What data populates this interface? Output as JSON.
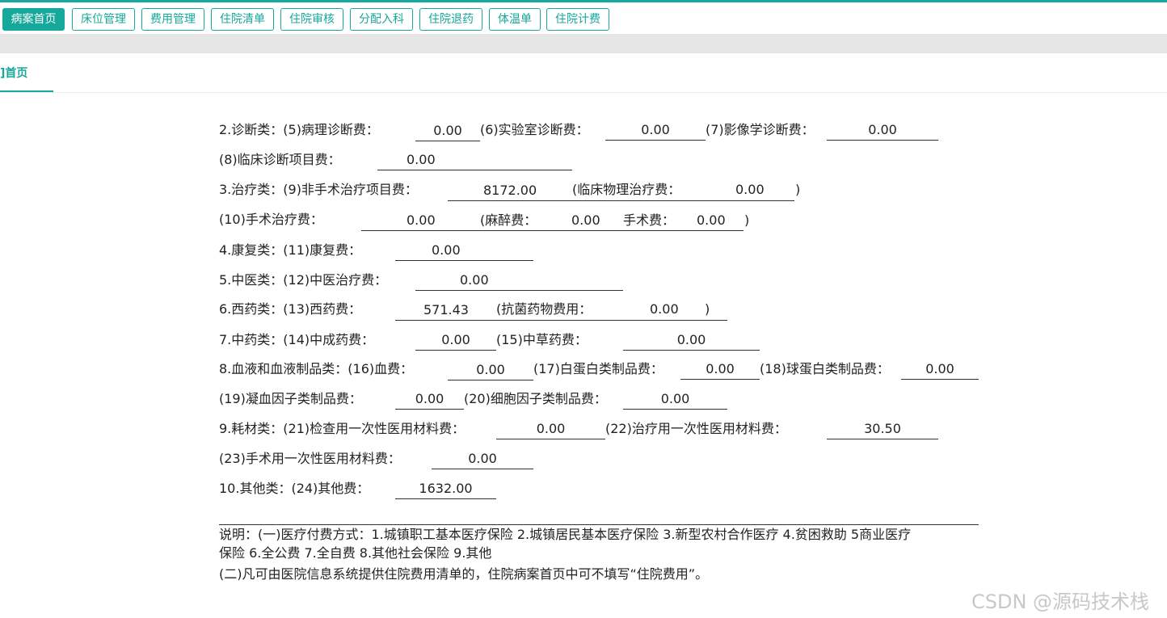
{
  "top_tabs": [
    {
      "label": "病案首页",
      "active": true
    },
    {
      "label": "床位管理"
    },
    {
      "label": "费用管理"
    },
    {
      "label": "住院清单"
    },
    {
      "label": "住院审核"
    },
    {
      "label": "分配入科"
    },
    {
      "label": "住院退药"
    },
    {
      "label": "体温单"
    },
    {
      "label": "住院计费"
    }
  ],
  "page_tab": {
    "label": "]首页"
  },
  "form": {
    "r1": {
      "a": "2.诊断类：(5)病理诊断费：",
      "v1": "0.00",
      "b": "(6)实验室诊断费：",
      "v2": "0.00",
      "c": "(7)影像学诊断费：",
      "v3": "0.00"
    },
    "r2": {
      "a": "(8)临床诊断项目费：",
      "v1": "0.00"
    },
    "r3": {
      "a": "3.治疗类：(9)非手术治疗项目费：",
      "v1": "8172.00",
      "b": "(临床物理治疗费：",
      "v2": "0.00",
      "close": ")"
    },
    "r4": {
      "a": "(10)手术治疗费：",
      "v1": "0.00",
      "b": "(麻醉费：",
      "v2": "0.00",
      "c": "手术费：",
      "v3": "0.00",
      "close": ")"
    },
    "r5": {
      "a": "4.康复类：(11)康复费：",
      "v1": "0.00"
    },
    "r6": {
      "a": "5.中医类：(12)中医治疗费：",
      "v1": "0.00"
    },
    "r7": {
      "a": "6.西药类：(13)西药费：",
      "v1": "571.43",
      "b": "(抗菌药物费用：",
      "v2": "0.00",
      "close": ")"
    },
    "r8": {
      "a": "7.中药类：(14)中成药费：",
      "v1": "0.00",
      "b": "(15)中草药费：",
      "v2": "0.00"
    },
    "r9": {
      "a": "8.血液和血液制品类：(16)血费：",
      "v1": "0.00",
      "b": "(17)白蛋白类制品费：",
      "v2": "0.00",
      "c": "(18)球蛋白类制品费：",
      "v3": "0.00"
    },
    "r10": {
      "a": "(19)凝血因子类制品费：",
      "v1": "0.00",
      "b": "(20)细胞因子类制品费：",
      "v2": "0.00"
    },
    "r11": {
      "a": "9.耗材类：(21)检查用一次性医用材料费：",
      "v1": "0.00",
      "b": "(22)治疗用一次性医用材料费：",
      "v2": "30.50"
    },
    "r12": {
      "a": "(23)手术用一次性医用材料费：",
      "v1": "0.00"
    },
    "r13": {
      "a": "10.其他类：(24)其他费：",
      "v1": "1632.00"
    }
  },
  "notes": {
    "line1": "说明：(一)医疗付费方式：1.城镇职工基本医疗保险 2.城镇居民基本医疗保险 3.新型农村合作医疗 4.贫困救助 5商业医疗",
    "line2": "保险 6.全公费 7.全自费 8.其他社会保险 9.其他",
    "line3": "(二)凡可由医院信息系统提供住院费用清单的，住院病案首页中可不填写“住院费用”。"
  },
  "watermark": "CSDN @源码技术栈",
  "colors": {
    "accent": "#16a89a",
    "gray_bar": "#e6e6e6"
  }
}
